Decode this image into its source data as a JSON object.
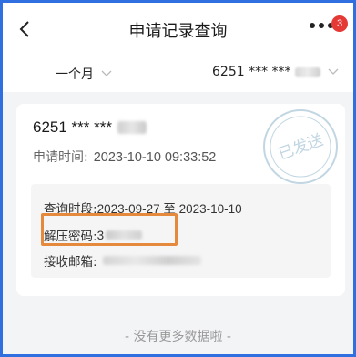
{
  "header": {
    "title": "申请记录查询",
    "badge_count": "3"
  },
  "filters": {
    "period": "一个月",
    "account": "6251 *** ***"
  },
  "record": {
    "account": "6251 *** ***",
    "apply_time_label": "申请时间:",
    "apply_time": "2023-10-10 09:33:52",
    "stamp_text": "已发送",
    "query_period_label": "查询时段:",
    "query_period": "2023-09-27 至 2023-10-10",
    "password_label": "解压密码:",
    "password_visible": "3",
    "email_label": "接收邮箱:"
  },
  "footer": {
    "text": "- 没有更多数据啦 -"
  },
  "colors": {
    "frame_border": "#2f6fe0",
    "highlight": "#e58a3c",
    "badge": "#e53935",
    "stamp": "#8fb6cc"
  }
}
